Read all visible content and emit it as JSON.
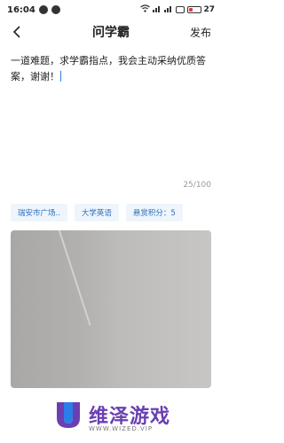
{
  "status_bar": {
    "time": "16:04",
    "battery": "27",
    "icons": [
      "notification-icon",
      "notification-icon",
      "wifi-icon",
      "signal-icon",
      "signal-icon",
      "mute-icon",
      "battery-icon"
    ]
  },
  "header": {
    "title": "问学霸",
    "publish_label": "发布",
    "back_icon": "chevron-left-icon"
  },
  "editor": {
    "text": "一道难题，求学霸指点，我会主动采纳优质答案，谢谢！",
    "counter": "25/100"
  },
  "tags": [
    {
      "label": "瑞安市广场.."
    },
    {
      "label": "大学英语"
    },
    {
      "label": "悬赏积分：5"
    }
  ],
  "watermark": {
    "brand": "维泽游戏",
    "sub": "WWW.WIZED.VIP",
    "colors": {
      "purple": "#6a3fb2",
      "blue": "#2b7de9"
    }
  },
  "colors": {
    "accent": "#2b7de9",
    "tag_bg": "#eef5fc",
    "tag_text": "#2b6fbd"
  }
}
